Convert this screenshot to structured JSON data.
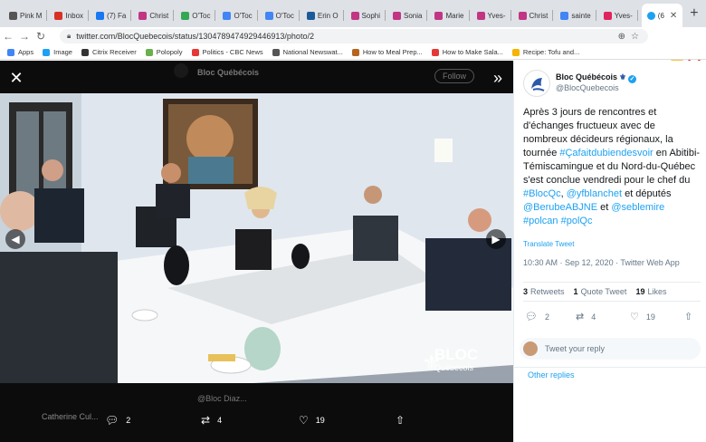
{
  "browser": {
    "tabs": [
      {
        "label": "Pink M",
        "icon": "pink-icon",
        "color": "#555555"
      },
      {
        "label": "Inbox",
        "icon": "gmail-icon",
        "color": "#d93025"
      },
      {
        "label": "(7) Fa",
        "icon": "facebook-icon",
        "color": "#1877f2"
      },
      {
        "label": "Christ",
        "icon": "instagram-icon",
        "color": "#c13584"
      },
      {
        "label": "O'Toc",
        "icon": "drive-icon",
        "color": "#34a853"
      },
      {
        "label": "O'Toc",
        "icon": "docs-icon",
        "color": "#4285f4"
      },
      {
        "label": "O'Toc",
        "icon": "docs-icon",
        "color": "#4285f4"
      },
      {
        "label": "Erin O",
        "icon": "chevron-icon",
        "color": "#1a5a9a"
      },
      {
        "label": "Sophi",
        "icon": "instagram-icon",
        "color": "#c13584"
      },
      {
        "label": "Sonia",
        "icon": "instagram-icon",
        "color": "#c13584"
      },
      {
        "label": "Marie",
        "icon": "instagram-icon",
        "color": "#c13584"
      },
      {
        "label": "Yves-",
        "icon": "instagram-icon",
        "color": "#c13584"
      },
      {
        "label": "Christ",
        "icon": "instagram-icon",
        "color": "#c13584"
      },
      {
        "label": "sainte",
        "icon": "google-icon",
        "color": "#4285f4"
      },
      {
        "label": "Yves-",
        "icon": "heart-icon",
        "color": "#e0245e"
      }
    ],
    "active_tab": {
      "label": "(6",
      "icon": "twitter-icon",
      "color": "#1da1f2"
    },
    "url": "twitter.com/BlocQuebecois/status/1304789474929446913/photo/2",
    "bookmarks": [
      {
        "label": "Apps",
        "color": "#4285f4"
      },
      {
        "label": "Image",
        "color": "#1da1f2"
      },
      {
        "label": "Citrix Receiver",
        "color": "#333333"
      },
      {
        "label": "Polopoly",
        "color": "#6ab04c"
      },
      {
        "label": "Politics - CBC News",
        "color": "#e53935"
      },
      {
        "label": "National Newswat...",
        "color": "#555555"
      },
      {
        "label": "How to Meal Prep...",
        "color": "#b5651d"
      },
      {
        "label": "How to Make Sala...",
        "color": "#e53935"
      },
      {
        "label": "Recipe: Tofu and...",
        "color": "#f4b400"
      }
    ]
  },
  "viewer": {
    "ghost_header_name": "Bloc Québécois",
    "ghost_follow": "Follow",
    "ghost_reply_name": "Catherine Cul...",
    "ghost_reply_handle": "@Bloc Diaz...",
    "watermark_line1": "BLOC",
    "watermark_line2": "Québécois",
    "replies": "2",
    "retweets": "4",
    "likes": "19"
  },
  "tweet": {
    "name": "Bloc Québécois",
    "handle": "@BlocQuebecois",
    "text_1": "Après 3 jours de rencontres et d'échanges fructueux avec de nombreux décideurs régionaux, la tournée ",
    "link_1": "#Çafaitdubiendesvoir",
    "text_2": " en Abitibi-Témiscamingue et du Nord-du-Québec s'est conclue vendredi pour le chef du ",
    "link_2": "#BlocQc",
    "text_3": ", ",
    "link_3": "@yfblanchet",
    "text_4": " et députés ",
    "link_4": "@BerubeABJNE",
    "text_5": " et ",
    "link_5": "@seblemire",
    "text_6": " ",
    "link_6": "#polcan",
    "text_7": " ",
    "link_7": "#polQc",
    "translate": "Translate Tweet",
    "meta": "10:30 AM · Sep 12, 2020 · Twitter Web App",
    "retweets_count": "3",
    "retweets_label": "Retweets",
    "quotes_count": "1",
    "quotes_label": "Quote Tweet",
    "likes_count": "19",
    "likes_label": "Likes",
    "action_replies": "2",
    "action_retweets": "4",
    "action_likes": "19",
    "reply_placeholder": "Tweet your reply",
    "other_replies": "Other replies"
  }
}
